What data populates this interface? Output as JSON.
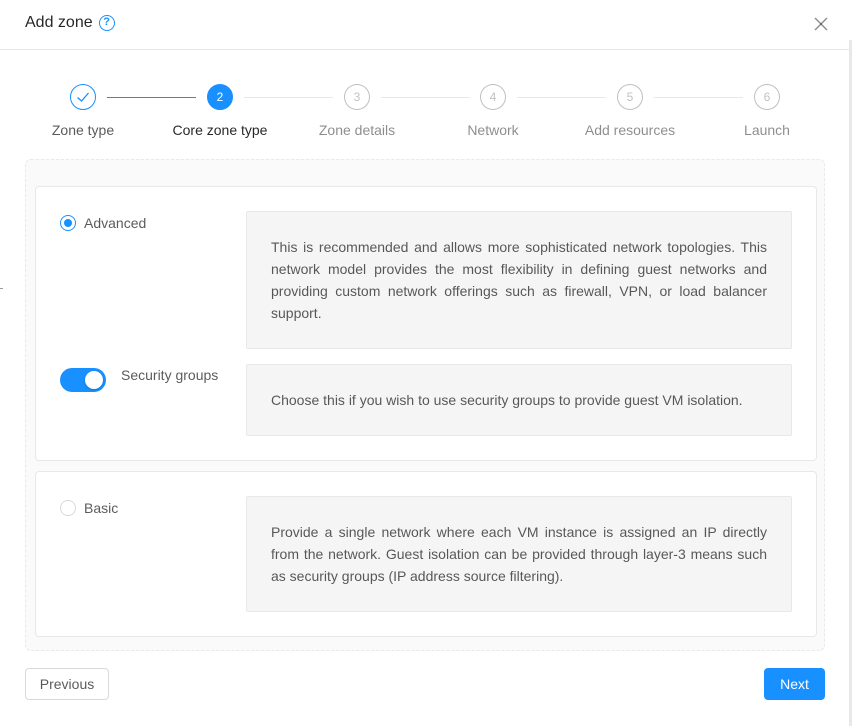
{
  "modal": {
    "title": "Add zone",
    "help_icon": "question-circle-icon",
    "close_icon": "close-icon"
  },
  "steps": [
    {
      "label": "Zone type",
      "number": "1",
      "status": "done",
      "icon": "check-icon"
    },
    {
      "label": "Core zone type",
      "number": "2",
      "status": "active"
    },
    {
      "label": "Zone details",
      "number": "3",
      "status": "wait"
    },
    {
      "label": "Network",
      "number": "4",
      "status": "wait"
    },
    {
      "label": "Add resources",
      "number": "5",
      "status": "wait"
    },
    {
      "label": "Launch",
      "number": "6",
      "status": "wait"
    }
  ],
  "options": {
    "advanced": {
      "label": "Advanced",
      "checked": true,
      "description": "This is recommended and allows more sophisticated network topologies. This network model provides the most flexibility in defining guest networks and providing custom network offerings such as firewall, VPN, or load balancer support."
    },
    "security_groups": {
      "label": "Security groups",
      "enabled": true,
      "description": "Choose this if you wish to use security groups to provide guest VM isolation."
    },
    "basic": {
      "label": "Basic",
      "checked": false,
      "description": "Provide a single network where each VM instance is assigned an IP directly from the network. Guest isolation can be provided through layer-3 means such as security groups (IP address source filtering)."
    }
  },
  "footer": {
    "previous_label": "Previous",
    "next_label": "Next"
  },
  "colors": {
    "primary": "#1890ff",
    "border": "#e8e8e8",
    "muted_text": "#bfbfbf"
  }
}
